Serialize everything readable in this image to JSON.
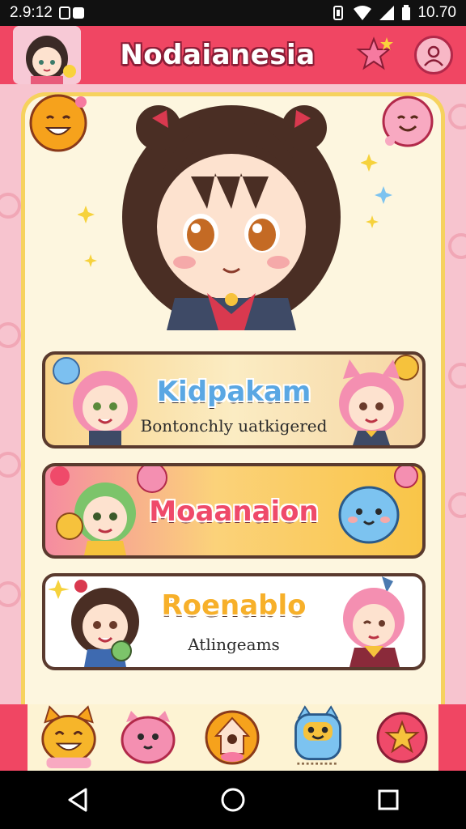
{
  "status_bar": {
    "time": "2.9:12",
    "battery": "10.70"
  },
  "header": {
    "title": "Nodaianesia"
  },
  "cards": [
    {
      "title": "Kidpakam",
      "subtitle": "Bontonchly uatkigered"
    },
    {
      "title": "Moaanaion",
      "subtitle": ""
    },
    {
      "title": "Roenablo",
      "subtitle": "Atlingeams"
    }
  ],
  "colors": {
    "accent": "#f04663",
    "panel": "#fdf6df",
    "border": "#f6d25e"
  },
  "icons": {
    "header": [
      "avatar",
      "star-icon",
      "profile-icon"
    ],
    "bottom_nav": [
      "cat-emoji-icon",
      "pink-blob-icon",
      "home-icon",
      "blue-creature-icon",
      "star-badge-icon"
    ],
    "system_nav": [
      "back-icon",
      "home-circle-icon",
      "recents-icon"
    ]
  }
}
